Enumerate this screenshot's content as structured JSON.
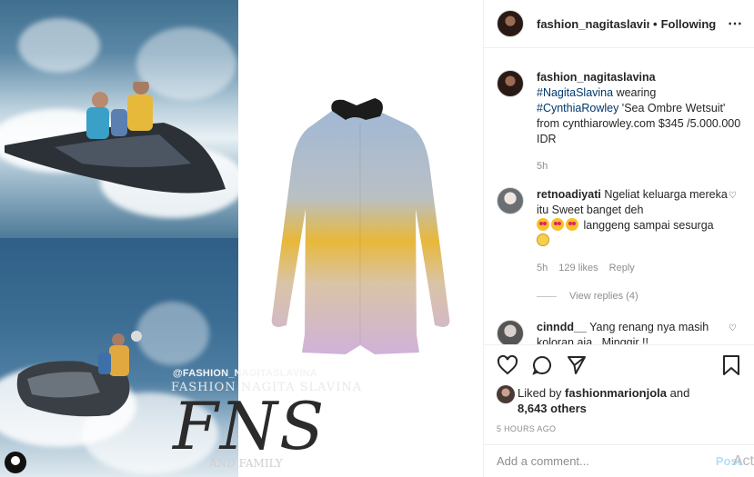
{
  "post": {
    "watermark_handle": "@FASHION_NAGITASLAVINA",
    "watermark_name": "FASHION NAGITA SLAVINA",
    "watermark_monogram": "FNS",
    "watermark_family": "AND FAMILY",
    "watermark_bottom": "FASHION NAGITA..."
  },
  "header": {
    "username": "fashion_nagitaslavina",
    "dot": "•",
    "follow_label": "Following",
    "more_icon": "⋯"
  },
  "caption": {
    "username": "fashion_nagitaslavina",
    "hashtag1": "#NagitaSlavina",
    "text1": " wearing ",
    "hashtag2": "#CynthiaRowley",
    "text2": " 'Sea Ombre Wetsuit' from cynthiarowley.com $345 /5.000.000 IDR",
    "time": "5h"
  },
  "comments": [
    {
      "username": "retnoadiyati",
      "text": "Ngeliat keluarga mereka itu Sweet banget deh",
      "text2": " langgeng sampai sesurga ",
      "time": "5h",
      "likes": "129 likes",
      "reply_label": "Reply",
      "view_replies": "View replies (4)"
    },
    {
      "username": "cinndd__",
      "text": "Yang renang nya masih koloran aja . Minggir !!"
    }
  ],
  "actions": {
    "liked_by_prefix": "Liked by ",
    "liked_by_user": "fashionmarionjola",
    "liked_by_and": " and",
    "others": "8,643 others",
    "time_ago": "5 HOURS AGO"
  },
  "add_comment": {
    "placeholder": "Add a comment...",
    "post_label": "Post",
    "overlay": "Act"
  },
  "icons": [
    "heart-icon",
    "comment-icon",
    "share-icon",
    "bookmark-icon"
  ]
}
